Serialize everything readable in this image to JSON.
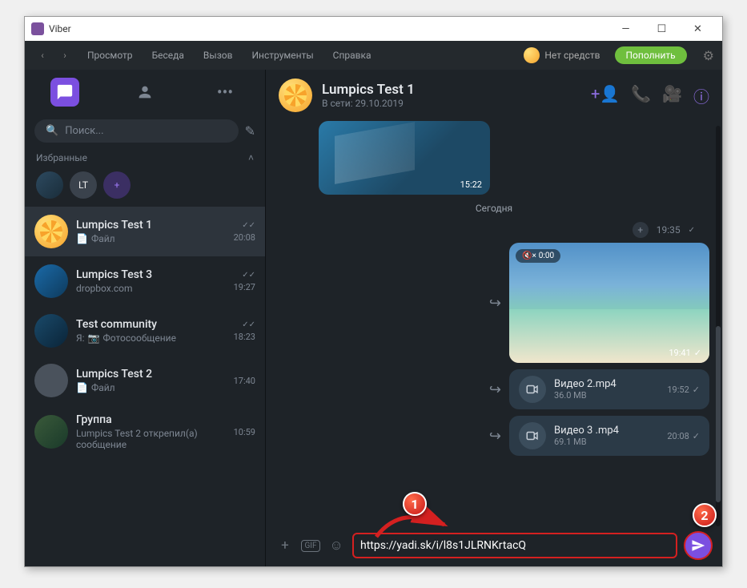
{
  "titlebar": {
    "app": "Viber"
  },
  "menu": {
    "view": "Просмотр",
    "chat": "Беседа",
    "call": "Вызов",
    "tools": "Инструменты",
    "help": "Справка",
    "no_funds": "Нет средств",
    "topup": "Пополнить"
  },
  "sidebar": {
    "search_placeholder": "Поиск...",
    "favorites_label": "Избранные",
    "fav_initials": "LT",
    "chats": [
      {
        "name": "Lumpics Test 1",
        "sub_icon": "📄",
        "sub": "Файл",
        "time": "20:08",
        "read": true,
        "active": true
      },
      {
        "name": "Lumpics Test 3",
        "sub": "dropbox.com",
        "time": "19:27",
        "read": true
      },
      {
        "name": "Test community",
        "sub_prefix": "Я:",
        "sub_icon": "📷",
        "sub": "Фотосообщение",
        "time": "18:23",
        "read": true
      },
      {
        "name": "Lumpics Test 2",
        "sub_icon": "📄",
        "sub": "Файл",
        "time": "17:40"
      },
      {
        "name": "Группа",
        "sub": "Lumpics Test 2 открепил(а) сообщение",
        "time": "10:59"
      }
    ]
  },
  "header": {
    "name": "Lumpics Test 1",
    "status": "В сети: 29.10.2019"
  },
  "messages": {
    "old_time": "15:22",
    "separator": "Сегодня",
    "plus_time": "19:35",
    "video_mute": "0:00",
    "video_time": "19:41",
    "files": [
      {
        "name": "Видео 2.mp4",
        "size": "36.0 MB",
        "time": "19:52"
      },
      {
        "name": "Видео 3 .mp4",
        "size": "69.1 MB",
        "time": "20:08"
      }
    ]
  },
  "input": {
    "value": "https://yadi.sk/i/l8s1JLRNKrtacQ"
  },
  "markers": {
    "one": "1",
    "two": "2"
  }
}
